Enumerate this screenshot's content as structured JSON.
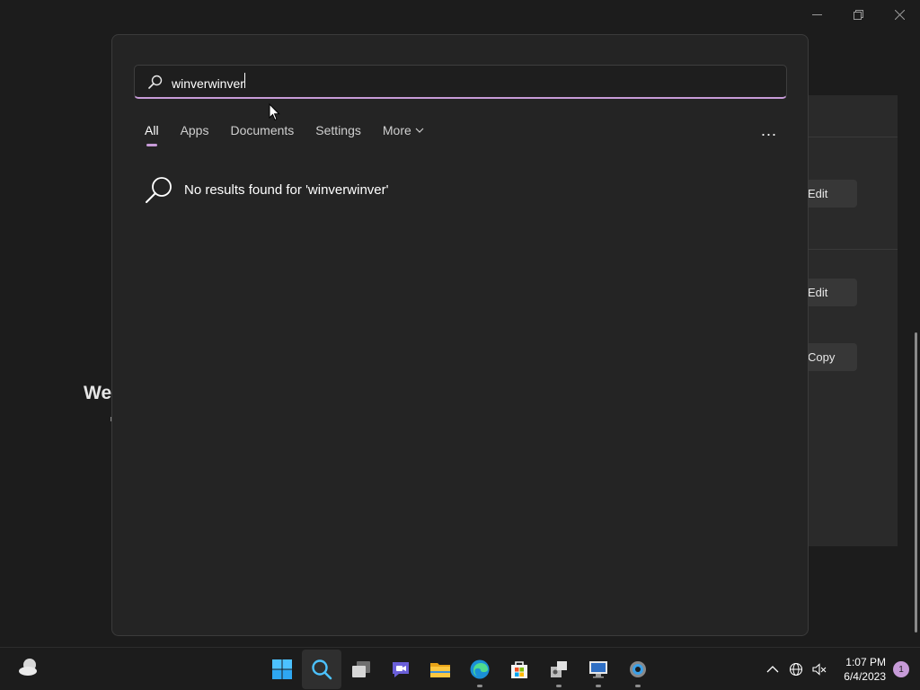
{
  "background_window": {
    "heading_partial": "We",
    "buttons": [
      "Edit",
      "Edit",
      "Copy"
    ]
  },
  "search": {
    "query": "winverwinver",
    "tabs": [
      {
        "label": "All",
        "active": true
      },
      {
        "label": "Apps",
        "active": false
      },
      {
        "label": "Documents",
        "active": false
      },
      {
        "label": "Settings",
        "active": false
      },
      {
        "label": "More",
        "active": false
      }
    ],
    "more_options": "...",
    "no_results_text": "No results found for 'winverwinver'"
  },
  "taskbar": {
    "apps": [
      {
        "name": "start",
        "icon": "windows-logo-icon"
      },
      {
        "name": "search",
        "icon": "search-icon",
        "active": true
      },
      {
        "name": "task-view",
        "icon": "task-view-icon"
      },
      {
        "name": "teams-chat",
        "icon": "chat-icon"
      },
      {
        "name": "file-explorer",
        "icon": "folder-icon"
      },
      {
        "name": "edge",
        "icon": "edge-icon",
        "running": true
      },
      {
        "name": "store",
        "icon": "store-icon"
      },
      {
        "name": "app-8",
        "icon": "tool-icon",
        "running": true
      },
      {
        "name": "app-9",
        "icon": "remote-desktop-icon",
        "running": true
      },
      {
        "name": "settings",
        "icon": "gear-icon",
        "running": true
      }
    ],
    "time": "1:07 PM",
    "date": "6/4/2023",
    "notification_count": "1"
  },
  "colors": {
    "accent": "#c79bd8",
    "flyout_bg": "#242424",
    "taskbar_bg": "#1c1c1c"
  }
}
